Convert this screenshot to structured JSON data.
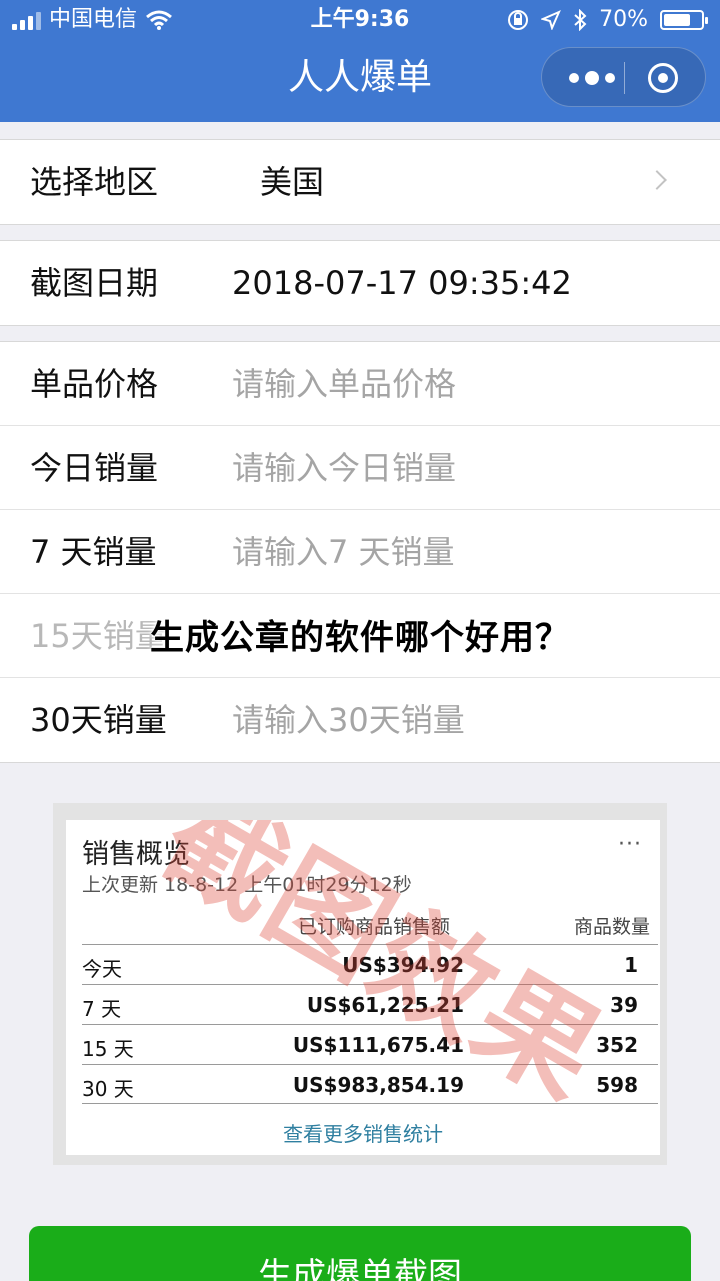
{
  "status_bar": {
    "carrier": "中国电信",
    "time": "上午9:36",
    "battery": "70%"
  },
  "nav": {
    "title": "人人爆单"
  },
  "form": {
    "region": {
      "label": "选择地区",
      "value": "美国"
    },
    "date": {
      "label": "截图日期",
      "value": "2018-07-17 09:35:42"
    },
    "fields": [
      {
        "label": "单品价格",
        "placeholder": "请输入单品价格"
      },
      {
        "label": "今日销量",
        "placeholder": "请输入今日销量"
      },
      {
        "label": "7 天销量",
        "placeholder": "请输入7 天销量"
      },
      {
        "label": "15天销量",
        "placeholder": ""
      },
      {
        "label": "30天销量",
        "placeholder": "请输入30天销量"
      }
    ]
  },
  "overlay_title": "生成公章的软件哪个好用？",
  "preview": {
    "title": "销售概览",
    "more": "···",
    "subtitle": "上次更新 18-8-12 上午01时29分12秒",
    "col_amount": "已订购商品销售额",
    "col_count": "商品数量",
    "rows": [
      {
        "period": "今天",
        "amount": "US$394.92",
        "count": "1"
      },
      {
        "period": "7 天",
        "amount": "US$61,225.21",
        "count": "39"
      },
      {
        "period": "15 天",
        "amount": "US$111,675.41",
        "count": "352"
      },
      {
        "period": "30 天",
        "amount": "US$983,854.19",
        "count": "598"
      }
    ],
    "link": "查看更多销售统计",
    "watermark": "截图效果"
  },
  "button": {
    "label": "生成爆单截图"
  },
  "colors": {
    "nav_bg": "#3f78d1",
    "button_bg": "#1aad19",
    "link": "#2f7fa0",
    "watermark": "#dc4637"
  }
}
